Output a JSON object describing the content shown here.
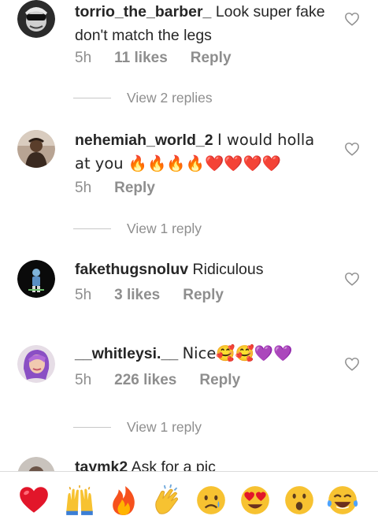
{
  "comments": [
    {
      "username": "torrio_the_barber_",
      "text": "Look super fake don't match the legs",
      "time": "5h",
      "likes": "11 likes",
      "reply": "Reply",
      "view_replies": "View 2 replies"
    },
    {
      "username": "nehemiah_world_2",
      "text": "I would holla at you 🔥🔥🔥🔥❤️❤️❤️❤️",
      "time": "5h",
      "reply": "Reply",
      "view_replies": "View 1 reply"
    },
    {
      "username": "fakethugsnoluv",
      "text": "Ridiculous",
      "time": "5h",
      "likes": "3 likes",
      "reply": "Reply"
    },
    {
      "username": "__whitleysi.__",
      "text": "Nice🥰🥰💜💜",
      "time": "5h",
      "likes": "226 likes",
      "reply": "Reply",
      "view_replies": "View 1 reply"
    },
    {
      "username": "taymk2",
      "text": "Ask for a pic"
    }
  ],
  "reactions": [
    "red-heart",
    "raising-hands",
    "fire",
    "clapping-hands",
    "crying-face",
    "heart-eyes-face",
    "astonished-face",
    "tears-of-joy-face"
  ],
  "colors": {
    "text": "#262626",
    "meta": "#8e8e8e",
    "divider": "#dbdbdb"
  }
}
